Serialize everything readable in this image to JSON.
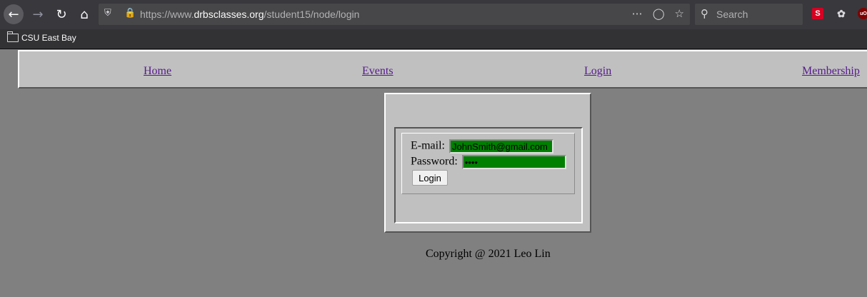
{
  "browser": {
    "url_prefix": "https://www.",
    "url_domain": "drbsclasses.org",
    "url_path": "/student15/node/login",
    "search_placeholder": "Search",
    "bookmark_label": "CSU East Bay",
    "ext_s_label": "S",
    "ext_ub_label": "uO"
  },
  "nav": {
    "home": "Home",
    "events": "Events",
    "login": "Login",
    "membership": "Membership"
  },
  "form": {
    "email_label": "E-mail:",
    "email_value": "JohnSmith@gmail.com",
    "password_label": "Password:",
    "password_value": "1234",
    "login_button": "Login"
  },
  "footer": {
    "copyright": "Copyright @ 2021 Leo Lin"
  },
  "colors": {
    "page_bg": "#808080",
    "panel_bg": "#c0c0c0",
    "input_bg": "#008000",
    "link": "#551a8b"
  }
}
